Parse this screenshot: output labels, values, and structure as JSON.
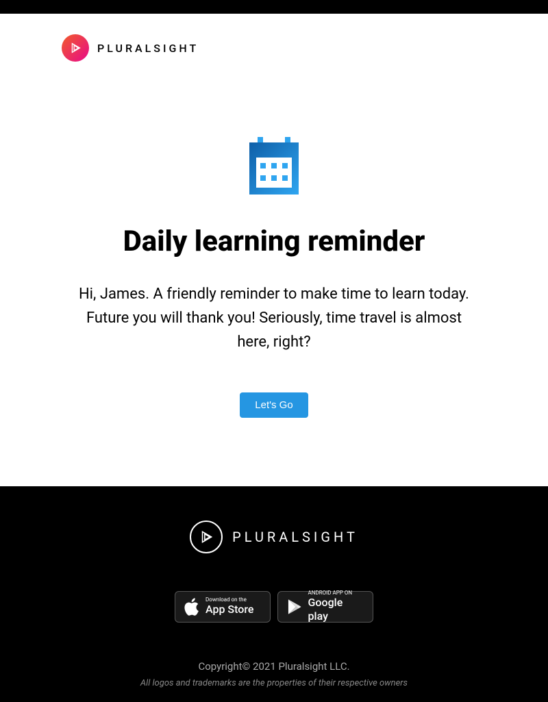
{
  "header": {
    "brand_name": "PLURALSIGHT"
  },
  "main": {
    "heading": "Daily learning reminder",
    "body": "Hi, James. A friendly reminder to make time to learn today. Future you will thank you! Seriously, time travel is almost here, right?",
    "cta_label": "Let's Go"
  },
  "footer": {
    "brand_name": "PLURALSIGHT",
    "app_store": {
      "small": "Download on the",
      "large": "App Store"
    },
    "google_play": {
      "small": "ANDROID APP ON",
      "large": "Google play"
    },
    "copyright": "Copyright© 2021 Pluralsight LLC.",
    "trademark": "All logos and trademarks are the properties of their respective owners"
  }
}
